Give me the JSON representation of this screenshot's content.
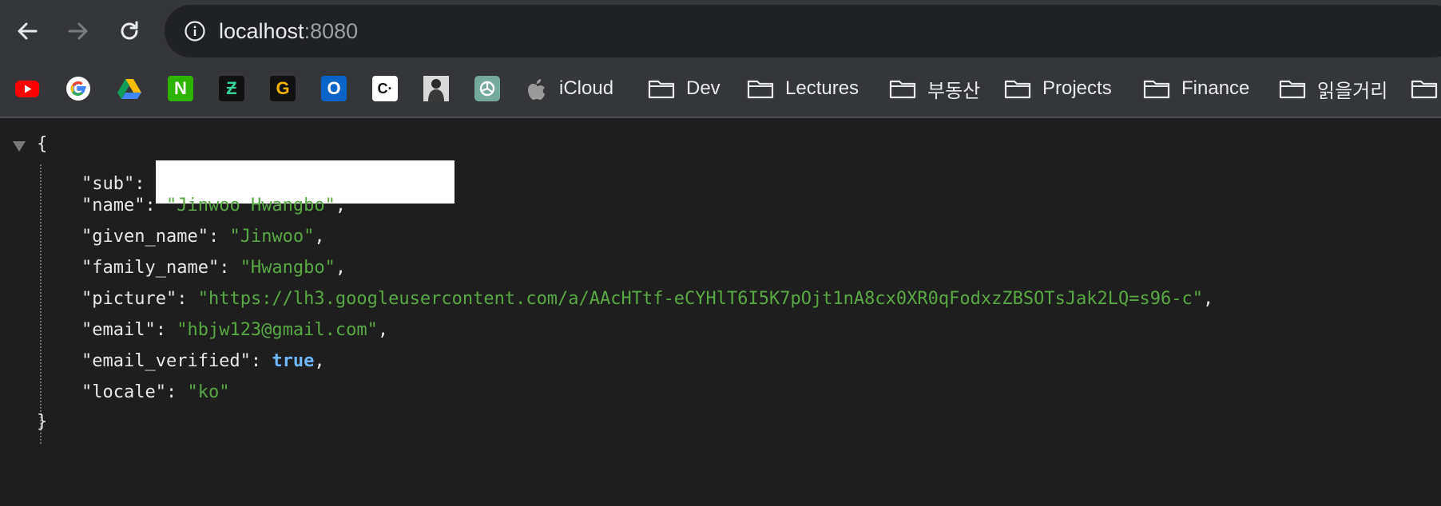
{
  "browser": {
    "url_host": "localhost",
    "url_port": ":8080"
  },
  "bookmarks": [
    {
      "name": "youtube",
      "label": "",
      "icon": "youtube-icon"
    },
    {
      "name": "google",
      "label": "",
      "icon": "google-icon"
    },
    {
      "name": "google-drive",
      "label": "",
      "icon": "google-drive-icon"
    },
    {
      "name": "naver",
      "label": "",
      "icon": "naver-icon",
      "glyph": "N"
    },
    {
      "name": "app-z",
      "label": "",
      "icon": "z-app-icon",
      "glyph": "Ƶ"
    },
    {
      "name": "app-g",
      "label": "",
      "icon": "g-app-icon",
      "glyph": "G"
    },
    {
      "name": "outlook",
      "label": "",
      "icon": "outlook-icon",
      "glyph": "O"
    },
    {
      "name": "app-c",
      "label": "",
      "icon": "c-app-icon",
      "glyph": "C·"
    },
    {
      "name": "profile-photo",
      "label": "",
      "icon": "person-photo-icon"
    },
    {
      "name": "chatgpt",
      "label": "",
      "icon": "chatgpt-icon"
    },
    {
      "name": "icloud",
      "label": "iCloud",
      "icon": "apple-icon"
    },
    {
      "name": "dev",
      "label": "Dev",
      "icon": "folder-icon"
    },
    {
      "name": "lectures",
      "label": "Lectures",
      "icon": "folder-icon"
    },
    {
      "name": "realestate",
      "label": "부동산",
      "icon": "folder-icon"
    },
    {
      "name": "projects",
      "label": "Projects",
      "icon": "folder-icon"
    },
    {
      "name": "finance",
      "label": "Finance",
      "icon": "folder-icon"
    },
    {
      "name": "reading",
      "label": "읽을거리",
      "icon": "folder-icon"
    }
  ],
  "json_view": {
    "open_brace": "{",
    "close_brace": "}",
    "fields": [
      {
        "key": "\"sub\"",
        "sep": ": ",
        "value": "",
        "redacted": true,
        "type": "redacted",
        "comma": ""
      },
      {
        "key": "\"name\"",
        "sep": ": ",
        "value": "\"Jinwoo Hwangbo\"",
        "type": "string",
        "comma": ","
      },
      {
        "key": "\"given_name\"",
        "sep": ": ",
        "value": "\"Jinwoo\"",
        "type": "string",
        "comma": ","
      },
      {
        "key": "\"family_name\"",
        "sep": ": ",
        "value": "\"Hwangbo\"",
        "type": "string",
        "comma": ","
      },
      {
        "key": "\"picture\"",
        "sep": ": ",
        "value": "\"https://lh3.googleusercontent.com/a/AAcHTtf-eCYHlT6I5K7pOjt1nA8cx0XR0qFodxzZBSOTsJak2LQ=s96-c\"",
        "type": "string",
        "comma": ","
      },
      {
        "key": "\"email\"",
        "sep": ": ",
        "value": "\"hbjw123@gmail.com\"",
        "type": "string",
        "comma": ","
      },
      {
        "key": "\"email_verified\"",
        "sep": ": ",
        "value": "true",
        "type": "bool",
        "comma": ","
      },
      {
        "key": "\"locale\"",
        "sep": ": ",
        "value": "\"ko\"",
        "type": "string",
        "comma": ""
      }
    ]
  },
  "colors": {
    "toolbar_bg": "#35363a",
    "omnibox_bg": "#202124",
    "page_bg": "#1e1e1e",
    "json_string": "#5aa845",
    "json_bool": "#6fb8ff",
    "json_key": "#e8e8e8"
  }
}
